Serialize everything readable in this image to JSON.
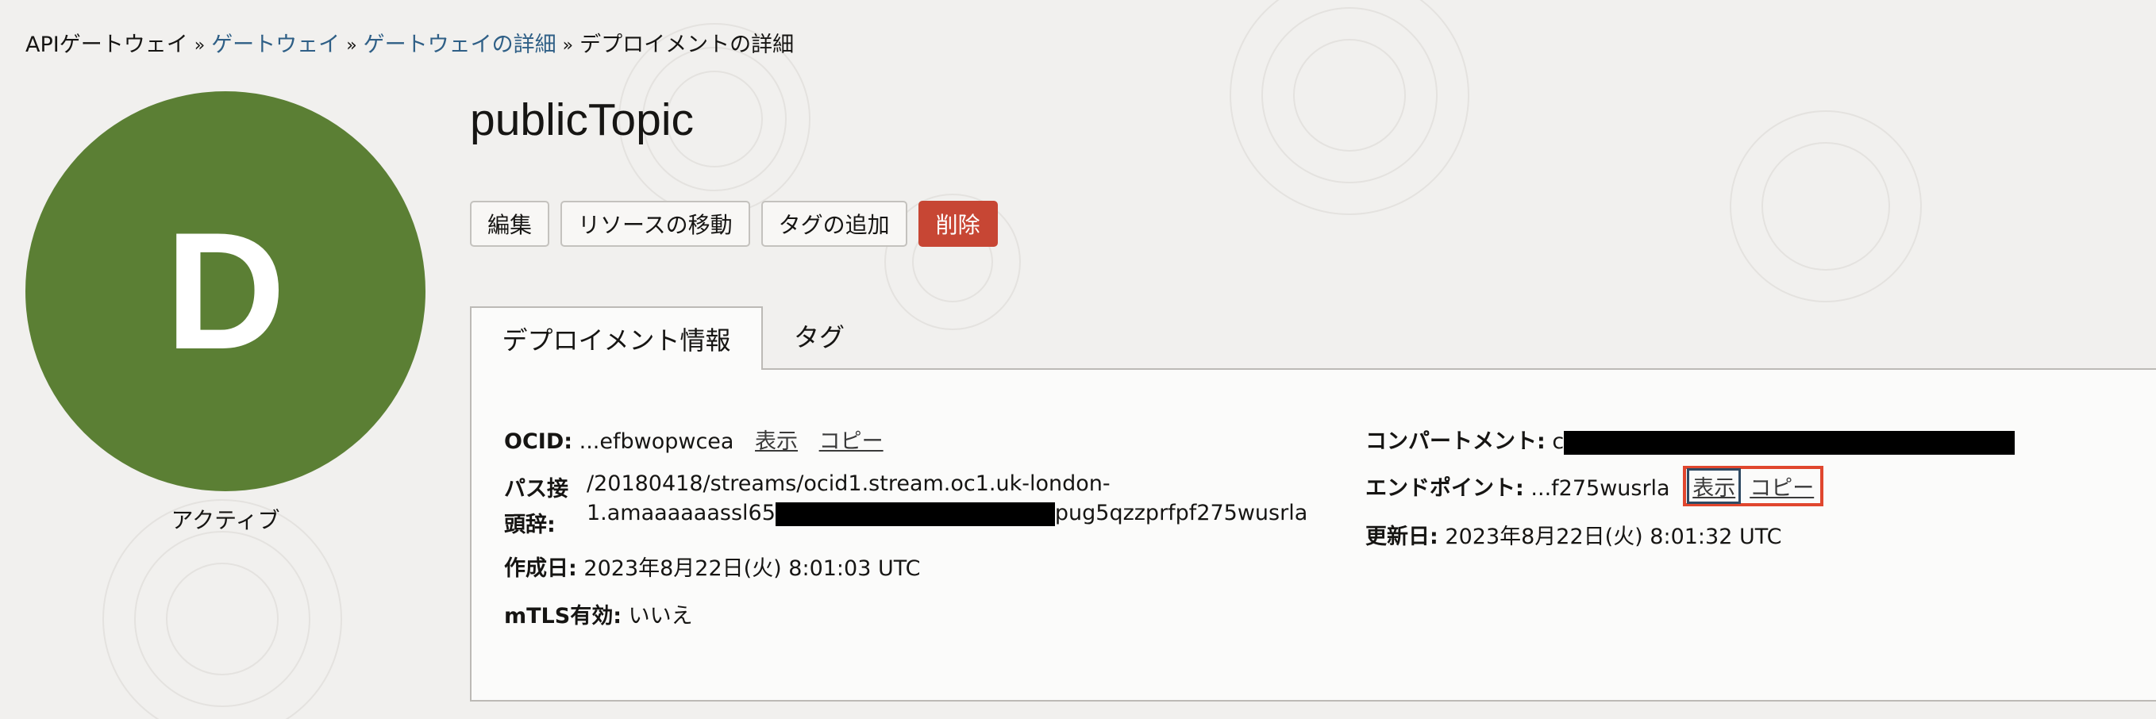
{
  "breadcrumb": {
    "items": [
      "APIゲートウェイ",
      "ゲートウェイ",
      "ゲートウェイの詳細",
      "デプロイメントの詳細"
    ],
    "separator": "»"
  },
  "avatar": {
    "letter": "D",
    "status": "アクティブ",
    "color": "#5b7f34"
  },
  "page_title": "publicTopic",
  "actions": {
    "edit": "編集",
    "move": "リソースの移動",
    "add_tags": "タグの追加",
    "delete": "削除"
  },
  "tabs": [
    "デプロイメント情報",
    "タグ"
  ],
  "info": {
    "ocid_label": "OCID:",
    "ocid_value": "...efbwopwcea",
    "show": "表示",
    "copy": "コピー",
    "path_label_1": "パス接",
    "path_label_2": "頭辞:",
    "path_line1": "/20180418/streams/ocid1.stream.oc1.uk-london-",
    "path_line2_pre": "1.amaaaaaassl65",
    "path_line2_post": "pug5qzzprfpf275wusrla",
    "created_label": "作成日:",
    "created_value": "2023年8月22日(火) 8:01:03 UTC",
    "mtls_label": "mTLS有効:",
    "mtls_value": "いいえ",
    "compartment_label": "コンパートメント:",
    "compartment_prefix": "c",
    "endpoint_label": "エンドポイント:",
    "endpoint_value": "...f275wusrla",
    "updated_label": "更新日:",
    "updated_value": "2023年8月22日(火) 8:01:32 UTC"
  },
  "colors": {
    "accent_link": "#2f5f86",
    "danger": "#c74634",
    "highlight": "#e0462e"
  }
}
